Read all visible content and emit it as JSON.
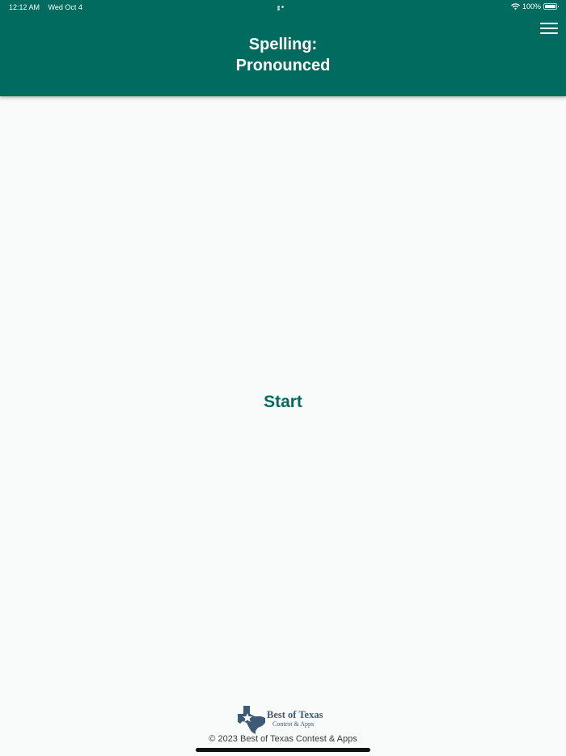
{
  "status_bar": {
    "time": "12:12 AM",
    "date": "Wed Oct 4",
    "battery": "100%"
  },
  "header": {
    "title_line1": "Spelling:",
    "title_line2": "Pronounced"
  },
  "main": {
    "start_label": "Start"
  },
  "footer": {
    "logo_name": "Best of Texas",
    "logo_sub": "Contest & Apps",
    "copyright": "© 2023 Best of Texas Contest & Apps"
  },
  "icons": {
    "menu": "hamburger-menu-icon",
    "wifi": "wifi-icon",
    "battery": "battery-icon",
    "multitask": "multitasking-dots-icon",
    "logo": "texas-star-icon"
  },
  "colors": {
    "header_background": "#006b5e",
    "accent": "#006b5e",
    "page_background": "#f8fbfa",
    "logo": "#3d5b76"
  }
}
